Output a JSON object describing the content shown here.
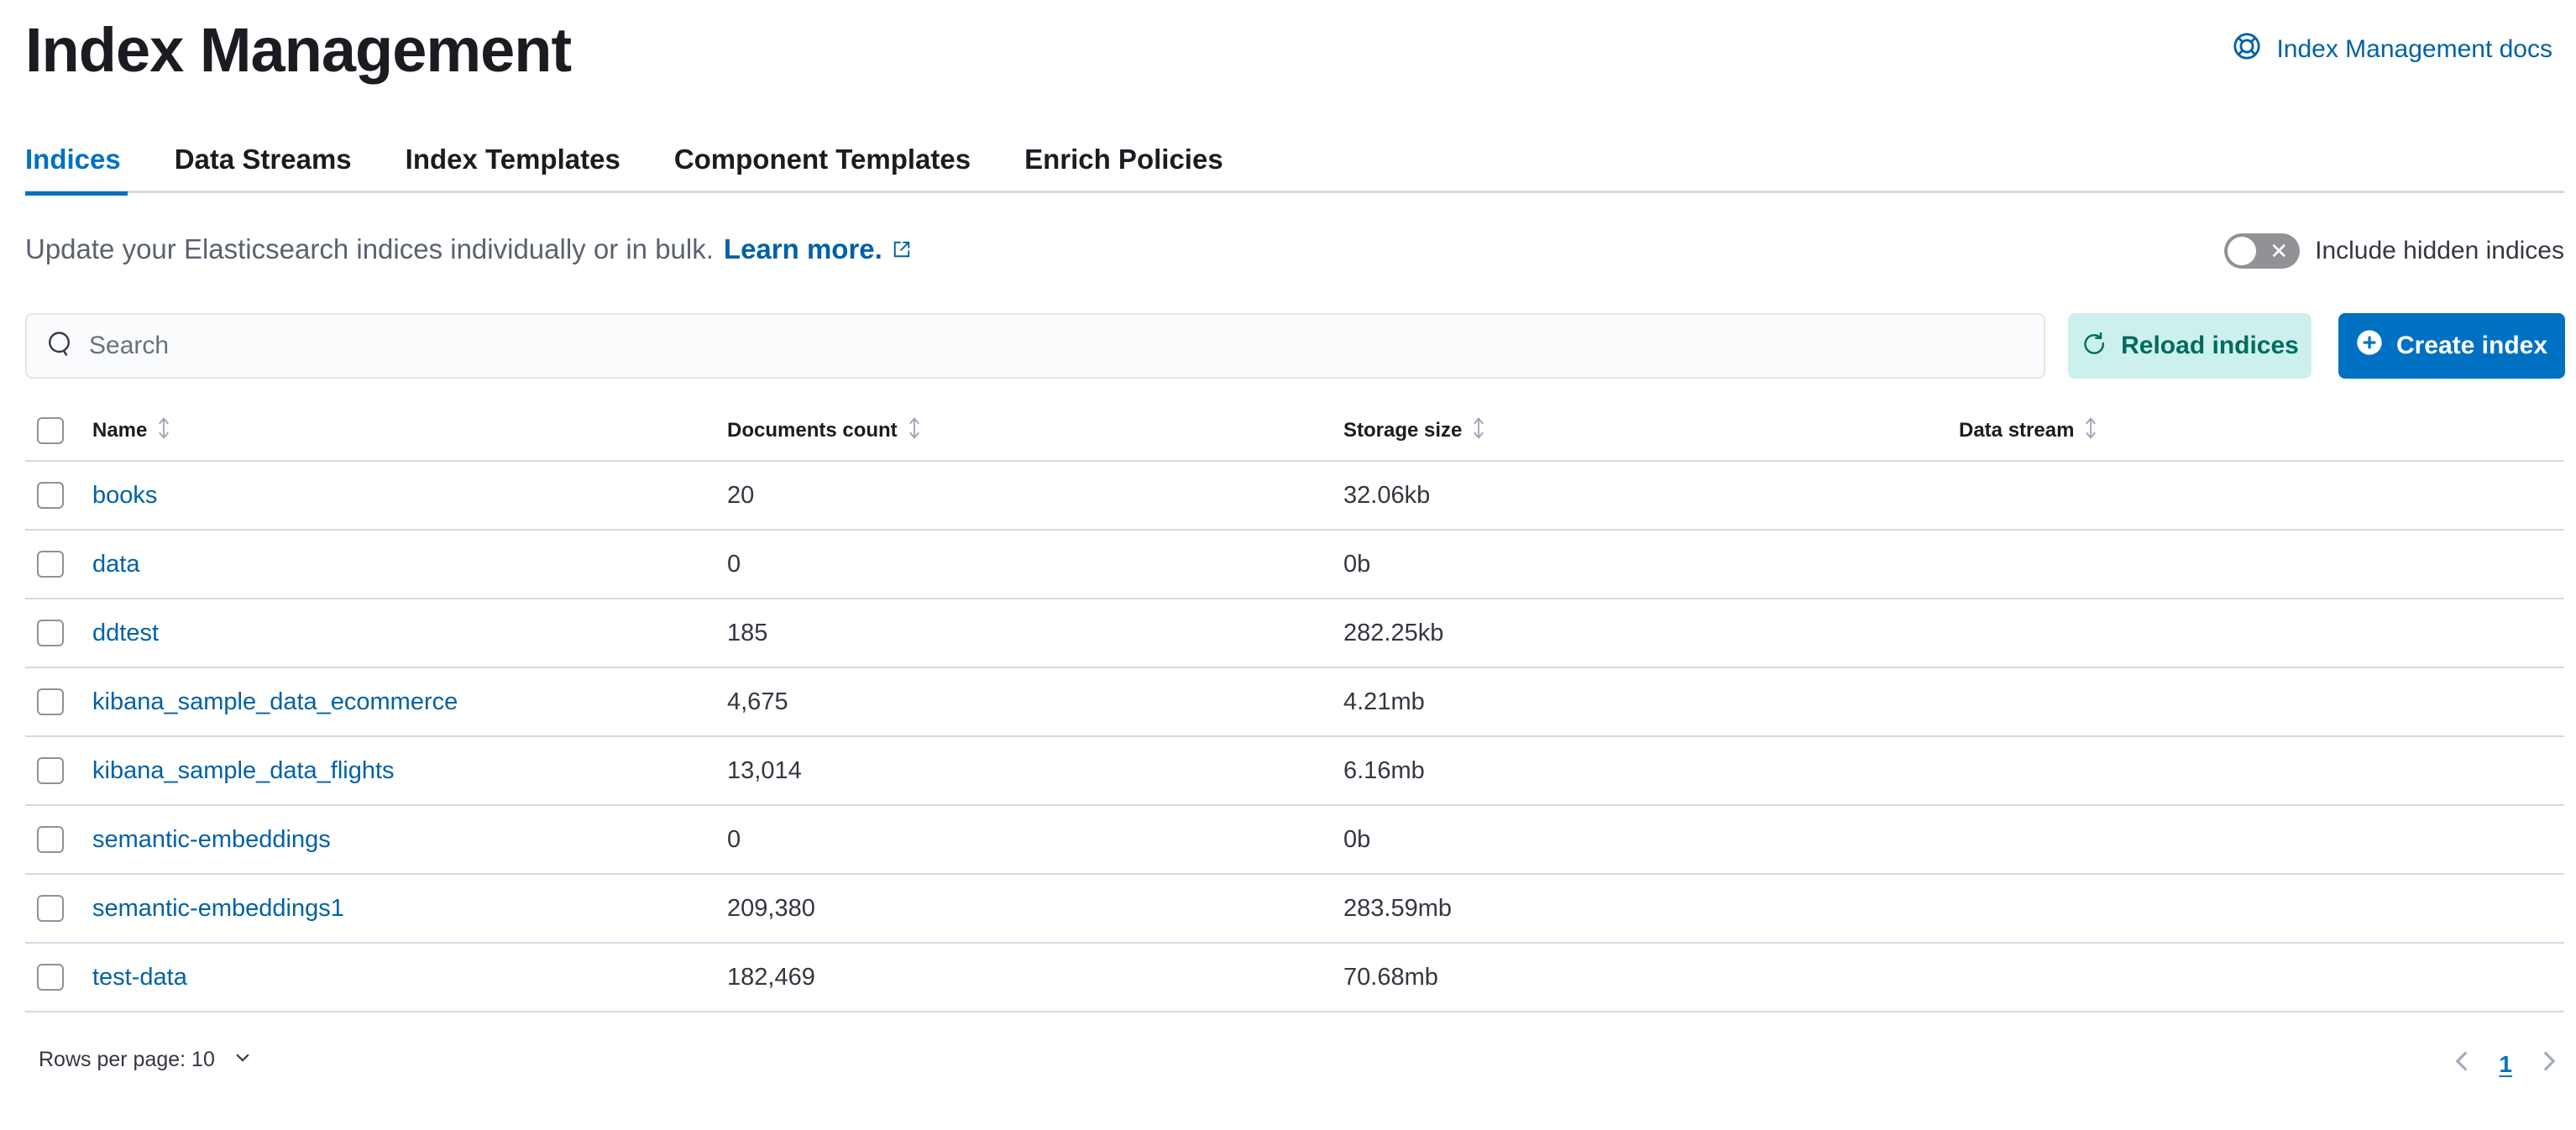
{
  "header": {
    "title": "Index Management",
    "docs_link": "Index Management docs",
    "docs_icon": "lifebuoy-icon"
  },
  "tabs": [
    {
      "label": "Indices",
      "active": true
    },
    {
      "label": "Data Streams",
      "active": false
    },
    {
      "label": "Index Templates",
      "active": false
    },
    {
      "label": "Component Templates",
      "active": false
    },
    {
      "label": "Enrich Policies",
      "active": false
    }
  ],
  "description": {
    "text": "Update your Elasticsearch indices individually or in bulk.",
    "link": "Learn more.",
    "link_icon": "external-link-icon"
  },
  "hidden_toggle": {
    "label": "Include hidden indices",
    "checked": false
  },
  "search": {
    "placeholder": "Search",
    "value": ""
  },
  "toolbar": {
    "reload_label": "Reload indices",
    "reload_icon": "refresh-icon",
    "create_label": "Create index",
    "create_icon": "plus-circle-icon"
  },
  "table": {
    "columns": [
      "Name",
      "Documents count",
      "Storage size",
      "Data stream"
    ],
    "rows": [
      {
        "name": "books",
        "docs": "20",
        "size": "32.06kb",
        "data_stream": ""
      },
      {
        "name": "data",
        "docs": "0",
        "size": "0b",
        "data_stream": ""
      },
      {
        "name": "ddtest",
        "docs": "185",
        "size": "282.25kb",
        "data_stream": ""
      },
      {
        "name": "kibana_sample_data_ecommerce",
        "docs": "4,675",
        "size": "4.21mb",
        "data_stream": ""
      },
      {
        "name": "kibana_sample_data_flights",
        "docs": "13,014",
        "size": "6.16mb",
        "data_stream": ""
      },
      {
        "name": "semantic-embeddings",
        "docs": "0",
        "size": "0b",
        "data_stream": ""
      },
      {
        "name": "semantic-embeddings1",
        "docs": "209,380",
        "size": "283.59mb",
        "data_stream": ""
      },
      {
        "name": "test-data",
        "docs": "182,469",
        "size": "70.68mb",
        "data_stream": ""
      }
    ]
  },
  "pagination": {
    "rows_per_page_label": "Rows per page: 10",
    "current_page": "1"
  },
  "colors": {
    "accent": "#0071c2",
    "link": "#0061a6",
    "reload_bg": "#ccf1ed",
    "reload_text": "#006b5e",
    "border": "#d3dae6"
  }
}
